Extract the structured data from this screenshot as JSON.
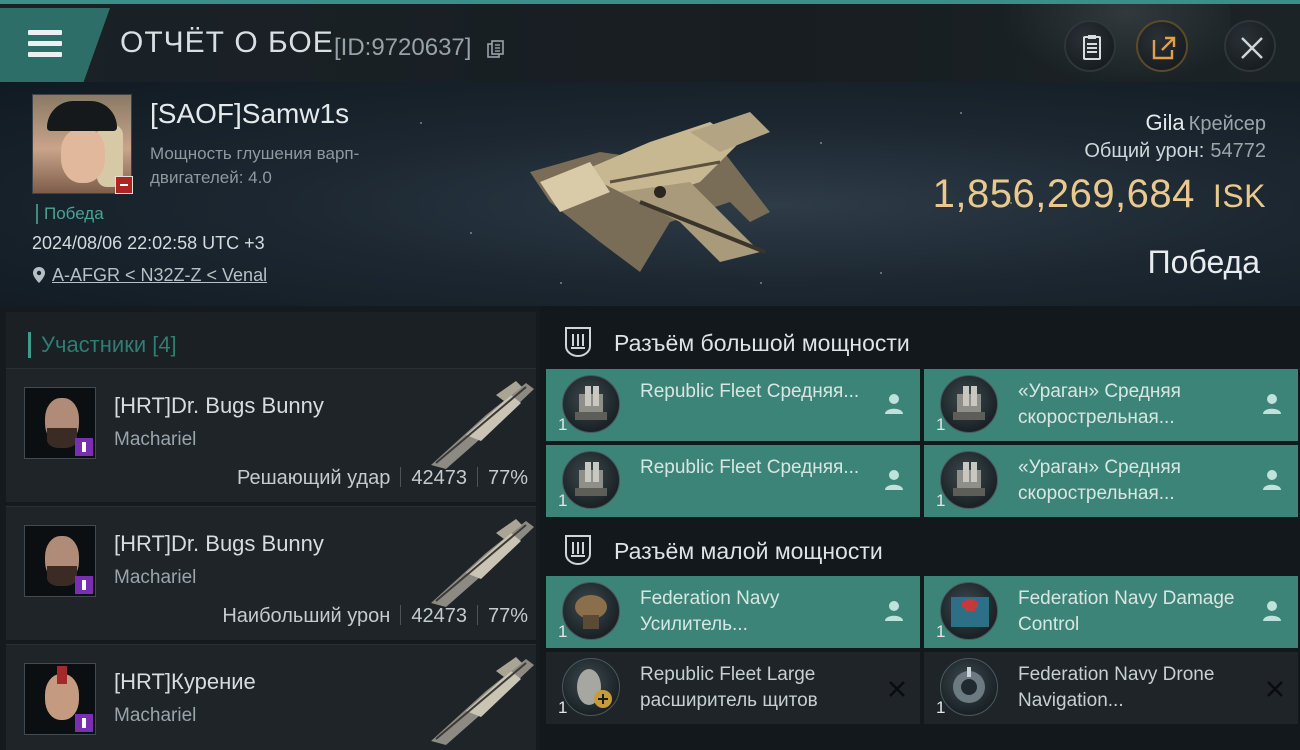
{
  "header": {
    "title": "ОТЧЁТ О БОЕ",
    "report_id": "[ID:9720637]"
  },
  "victim": {
    "name": "[SAOF]Samw1s",
    "attribute": "Мощность глушения варп-двигателей: 4.0",
    "result_tag": "Победа",
    "datetime": "2024/08/06 22:02:58 UTC +3",
    "location": "A-AFGR < N32Z-Z < Venal",
    "ship": "Gila",
    "ship_class": "Крейсер",
    "total_damage_label": "Общий урон:",
    "total_damage": "54772",
    "isk_value": "1,856,269,684",
    "isk_unit": "ISK",
    "result": "Победа"
  },
  "participants": {
    "label": "Участники [4]",
    "rows": [
      {
        "name": "[HRT]Dr. Bugs Bunny",
        "ship": "Machariel",
        "role": "Решающий удар",
        "damage": "42473",
        "percent": "77%"
      },
      {
        "name": "[HRT]Dr. Bugs Bunny",
        "ship": "Machariel",
        "role": "Наибольший урон",
        "damage": "42473",
        "percent": "77%"
      },
      {
        "name": "[HRT]Курение",
        "ship": "Machariel"
      }
    ]
  },
  "fitting": {
    "high_label": "Разъём большой мощности",
    "low_label": "Разъём малой мощности",
    "high": [
      {
        "qty": "1",
        "name": "Republic Fleet Средняя...",
        "status": "person"
      },
      {
        "qty": "1",
        "name": "«Ураган» Средняя скорострельная...",
        "status": "person"
      },
      {
        "qty": "1",
        "name": "Republic Fleet Средняя...",
        "status": "person"
      },
      {
        "qty": "1",
        "name": "«Ураган» Средняя скорострельная...",
        "status": "person"
      }
    ],
    "low": [
      {
        "qty": "1",
        "name": "Federation Navy Усилитель...",
        "status": "person"
      },
      {
        "qty": "1",
        "name": "Federation Navy Damage Control",
        "status": "person"
      },
      {
        "qty": "1",
        "name": "Republic Fleet Large расширитель щитов",
        "status": "destroyed"
      },
      {
        "qty": "1",
        "name": "Federation Navy Drone Navigation...",
        "status": "destroyed"
      }
    ]
  },
  "colors": {
    "accent": "#3d8478",
    "isk": "#e9c98e",
    "result": "#4aa395"
  },
  "icons": [
    "menu-icon",
    "copy-icon",
    "clipboard-icon",
    "share-icon",
    "close-icon",
    "location-pin-icon",
    "slot-shield-icon",
    "person-icon",
    "destroyed-x-icon"
  ]
}
